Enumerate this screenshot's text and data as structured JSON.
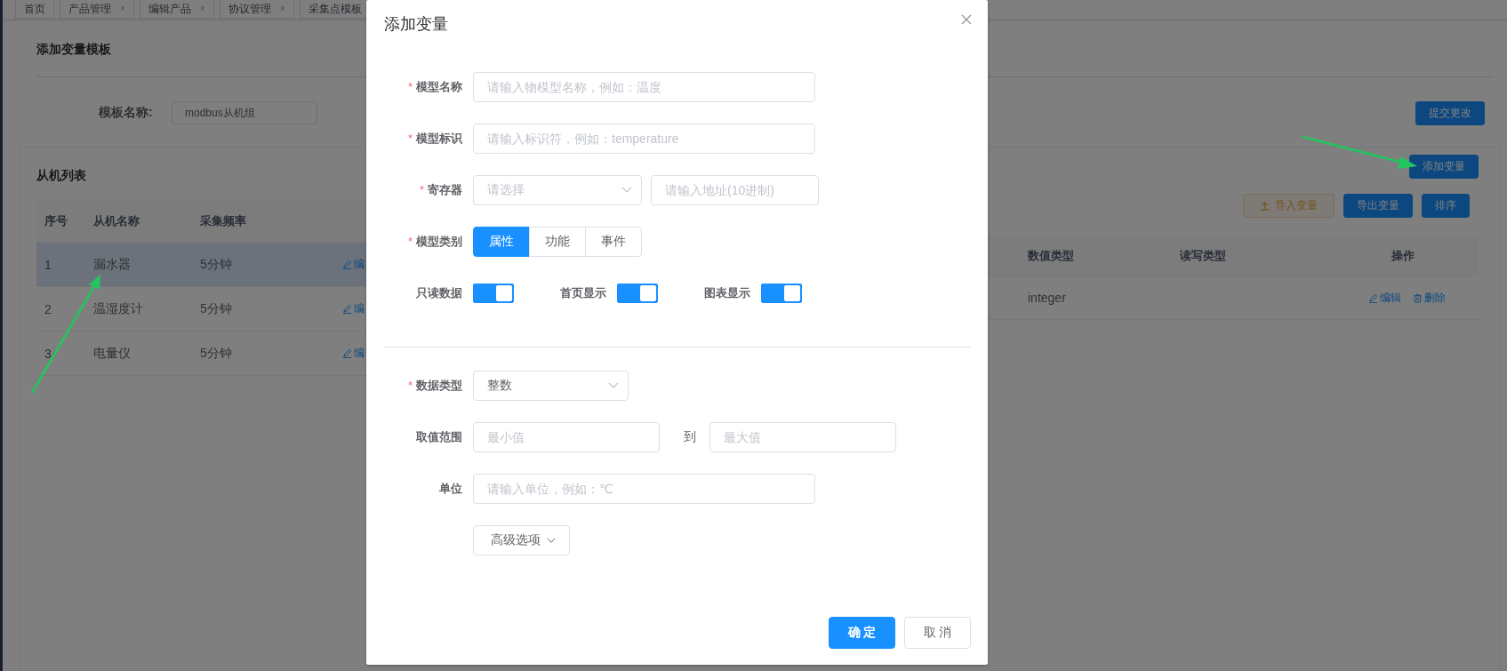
{
  "tabs": [
    {
      "label": "首页"
    },
    {
      "label": "产品管理",
      "close": "×"
    },
    {
      "label": "编辑产品",
      "close": "×"
    },
    {
      "label": "协议管理",
      "close": "×"
    },
    {
      "label": "采集点模板"
    }
  ],
  "page": {
    "title": "添加变量模板",
    "template_label": "模板名称:",
    "template_value": "modbus从机组",
    "submit_button": "提交更改"
  },
  "slave_list": {
    "title": "从机列表",
    "columns": [
      "序号",
      "从机名称",
      "采集频率"
    ],
    "rows": [
      {
        "cells": [
          "1",
          "漏水器",
          "5分钟"
        ],
        "action": "编",
        "selected": true
      },
      {
        "cells": [
          "2",
          "温湿度计",
          "5分钟"
        ],
        "action": "编",
        "selected": false
      },
      {
        "cells": [
          "3",
          "电量仪",
          "5分钟"
        ],
        "action": "编",
        "selected": false
      }
    ]
  },
  "variables": {
    "add_button": "添加变量",
    "import_button": "导入变量",
    "export_button": "导出变量",
    "sort_button": "排序",
    "columns": [
      "数值类型",
      "读写类型",
      "操作"
    ],
    "rows": [
      {
        "value_type": "integer",
        "actions": [
          {
            "kind": "edit",
            "label": "编辑"
          },
          {
            "kind": "delete",
            "label": "删除"
          }
        ]
      }
    ]
  },
  "dialog": {
    "title": "添加变量",
    "fields": [
      {
        "kind": "input",
        "mark": "*",
        "label": "模型名称",
        "placeholder": "请输入物模型名称，例如：温度"
      },
      {
        "kind": "input",
        "mark": "*",
        "label": "模型标识",
        "placeholder": "请输入标识符，例如：temperature"
      },
      {
        "kind": "select_input",
        "mark": "*",
        "label": "寄存器",
        "placeholder": "请选择",
        "input_placeholder": "请输入地址(10进制)"
      },
      {
        "kind": "segmented",
        "mark": "*",
        "label": "模型类别",
        "options": [
          {
            "label": "属性",
            "selected": true
          },
          {
            "label": "功能",
            "selected": false
          },
          {
            "label": "事件",
            "selected": false
          }
        ]
      },
      {
        "kind": "switches",
        "items": [
          {
            "label": "只读数据",
            "on": true
          },
          {
            "label": "首页显示",
            "on": true
          },
          {
            "label": "图表显示",
            "on": true
          }
        ]
      },
      {
        "kind": "divider"
      },
      {
        "kind": "select",
        "mark": "*",
        "label": "数据类型",
        "value": "整数"
      },
      {
        "kind": "range",
        "label": "取值范围",
        "min_placeholder": "最小值",
        "separator": "到",
        "max_placeholder": "最大值"
      },
      {
        "kind": "input",
        "label": "单位",
        "placeholder": "请输入单位，例如：℃"
      },
      {
        "kind": "button",
        "label": "高级选项"
      }
    ],
    "confirm_button": "确 定",
    "cancel_button": "取 消"
  }
}
